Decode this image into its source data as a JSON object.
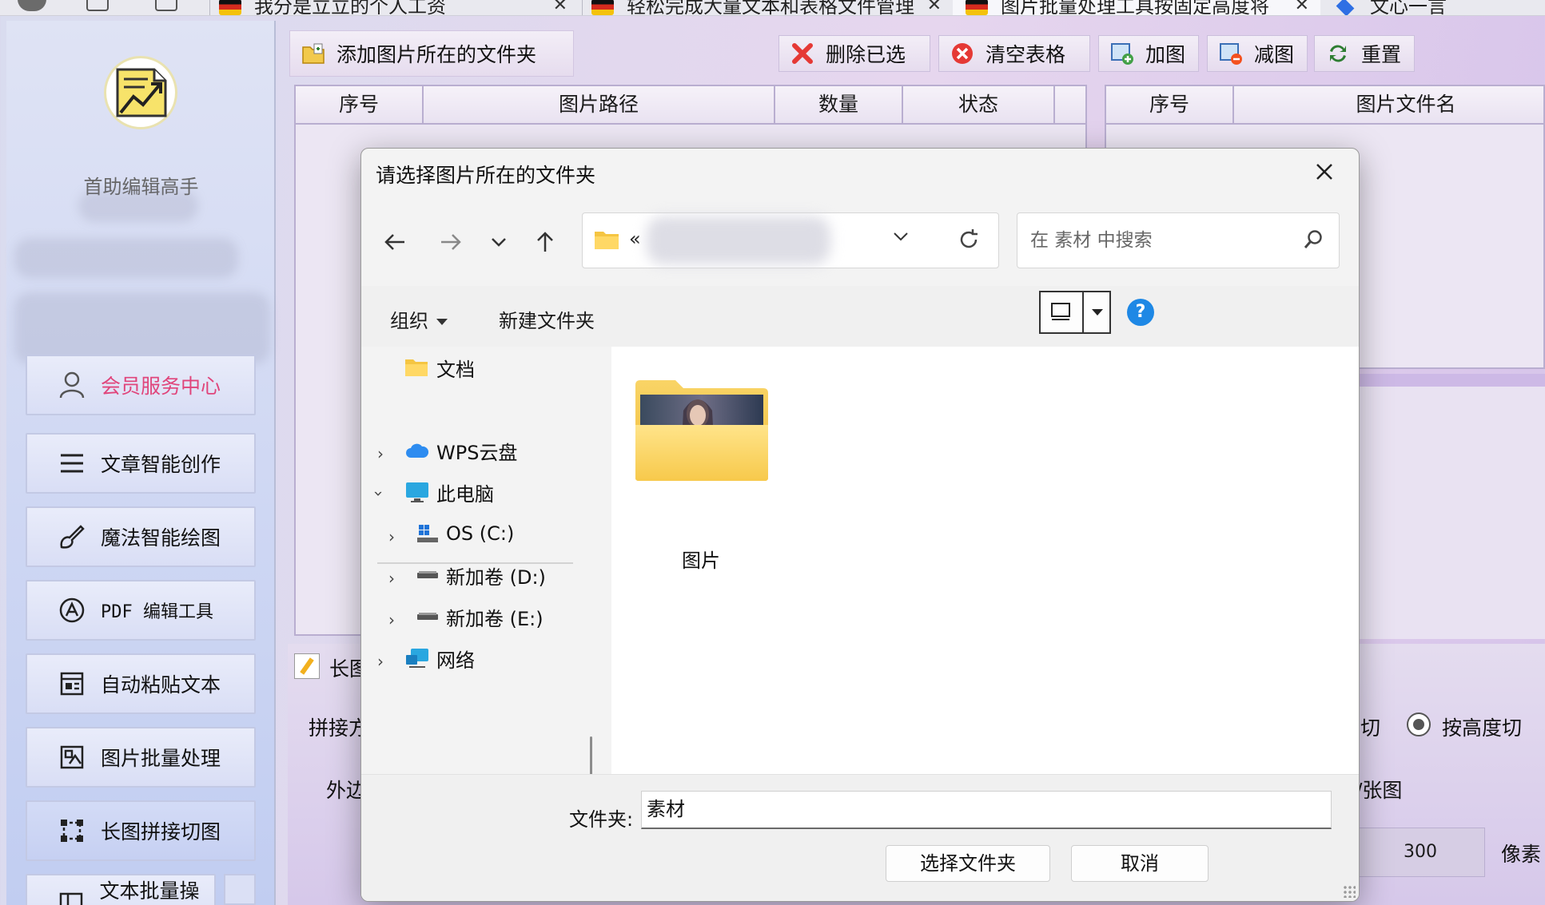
{
  "browser": {
    "tabs": [
      {
        "title": "我分是立立的个人工资"
      },
      {
        "title": "轻松完成大量文本和表格文件管理"
      },
      {
        "title": "图片批量处理工具按固定高度将"
      },
      {
        "title": "文心一言"
      }
    ]
  },
  "sidebar": {
    "app_name": "首助编辑高手",
    "member_button": "会员服务中心",
    "items": [
      {
        "label": "文章智能创作",
        "icon": "list-icon"
      },
      {
        "label": "魔法智能绘图",
        "icon": "brush-icon"
      },
      {
        "label": "PDF 编辑工具",
        "icon": "pdf-icon"
      },
      {
        "label": "自动粘贴文本",
        "icon": "paste-icon"
      },
      {
        "label": "图片批量处理",
        "icon": "image-icon"
      },
      {
        "label": "长图拼接切图",
        "icon": "crop-icon"
      },
      {
        "label": "文本批量操作",
        "icon": "text-icon"
      }
    ]
  },
  "toolbar": {
    "add_folder": "添加图片所在的文件夹",
    "delete_selected": "删除已选",
    "clear_table": "清空表格",
    "add_image": "加图",
    "remove_image": "减图",
    "reset": "重置"
  },
  "left_table": {
    "columns": [
      "序号",
      "图片路径",
      "数量",
      "状态"
    ]
  },
  "right_table": {
    "columns": [
      "序号",
      "图片文件名"
    ]
  },
  "lower_panel": {
    "section_title": "长图",
    "mode_label": "拼接方",
    "margin_label": "外边",
    "cut_label_tail": "切",
    "by_height_option": "按高度切",
    "per_image_label": "/张图",
    "height_value": "300",
    "unit_label": "像素"
  },
  "dialog": {
    "title": "请选择图片所在的文件夹",
    "address_crumb": "«",
    "search_placeholder": "在 素材 中搜索",
    "organize": "组织",
    "new_folder": "新建文件夹",
    "help": "?",
    "nav_items": [
      {
        "label": "文档"
      },
      {
        "label": "WPS云盘"
      },
      {
        "label": "此电脑"
      },
      {
        "label": "OS (C:)"
      },
      {
        "label": "新加卷 (D:)"
      },
      {
        "label": "新加卷 (E:)"
      },
      {
        "label": "网络"
      }
    ],
    "folders": [
      {
        "name": "图片"
      }
    ],
    "folder_label": "文件夹:",
    "folder_value": "素材",
    "select_button": "选择文件夹",
    "cancel_button": "取消"
  }
}
